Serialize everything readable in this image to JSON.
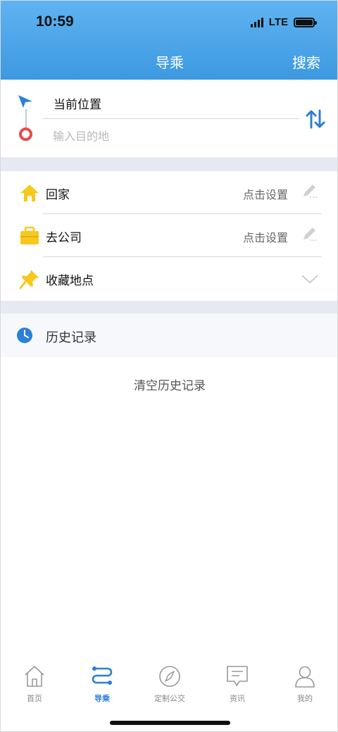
{
  "status": {
    "time": "10:59",
    "network": "LTE"
  },
  "nav": {
    "title": "导乘",
    "search": "搜索"
  },
  "route": {
    "current_location": "当前位置",
    "destination_placeholder": "输入目的地"
  },
  "shortcuts": [
    {
      "label": "回家",
      "hint": "点击设置"
    },
    {
      "label": "去公司",
      "hint": "点击设置"
    },
    {
      "label": "收藏地点"
    }
  ],
  "history": {
    "title": "历史记录",
    "clear": "清空历史记录"
  },
  "tabs": [
    {
      "label": "首页"
    },
    {
      "label": "导乘",
      "active": true
    },
    {
      "label": "定制公交"
    },
    {
      "label": "资讯"
    },
    {
      "label": "我的"
    }
  ],
  "colors": {
    "header": "#4fa8ea",
    "accent": "#2b7fd6",
    "destination": "#e84a4a",
    "icon_yellow": "#f7c81e"
  }
}
